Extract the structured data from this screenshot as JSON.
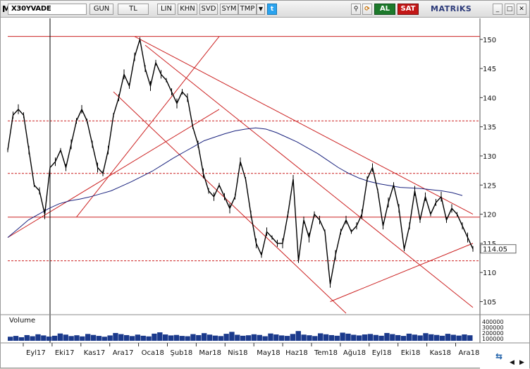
{
  "toolbar": {
    "symbol": "X30YVADE",
    "period": "GUN",
    "currency": "TL",
    "buttons": [
      "LIN",
      "KHN",
      "SVD",
      "SYM",
      "TMP"
    ],
    "buy": "AL",
    "sell": "SAT",
    "brand": "MATRiKS"
  },
  "chart_data": {
    "type": "line",
    "price_ticks": [
      150,
      145,
      140,
      135,
      130,
      125,
      120,
      115,
      110,
      105
    ],
    "last_price": "114.05",
    "x_labels": [
      "Eyl17",
      "Eki17",
      "Kas17",
      "Ara17",
      "Oca18",
      "Şub18",
      "Mar18",
      "Nis18",
      "May18",
      "Haz18",
      "Tem18",
      "Ağu18",
      "Eyl18",
      "Eki18",
      "Kas18",
      "Ara18"
    ],
    "volume_title": "Volume",
    "volume_ticks": [
      "400000",
      "300000",
      "200000",
      "100000"
    ],
    "series": [
      {
        "values": [
          131,
          137,
          138,
          137,
          131,
          125,
          124,
          120,
          128,
          129,
          131,
          128,
          132,
          136,
          138,
          136,
          132,
          128,
          127,
          131,
          137,
          140,
          144,
          142,
          147,
          150,
          145,
          142,
          146,
          144,
          143,
          141,
          139,
          141,
          140,
          135,
          132,
          127,
          124,
          123,
          125,
          123,
          121,
          123,
          129,
          126,
          120,
          115,
          113,
          117,
          116,
          115,
          115,
          120,
          126,
          112,
          119,
          116,
          120,
          119,
          117,
          108,
          113,
          117,
          119,
          117,
          118,
          120,
          126,
          128,
          124,
          118,
          122,
          125,
          121,
          114,
          118,
          124,
          119,
          123,
          120,
          122,
          123,
          119,
          121,
          120,
          118,
          116,
          114.05
        ]
      },
      {
        "values": [
          116,
          117.5,
          119,
          120,
          121,
          121.8,
          122.3,
          122.6,
          123,
          123.5,
          124,
          124.8,
          125.6,
          126.5,
          127.4,
          128.5,
          129.6,
          130.6,
          131.6,
          132.6,
          133.2,
          133.8,
          134.3,
          134.6,
          134.8,
          134.6,
          134,
          133.2,
          132.4,
          131.4,
          130.4,
          129.2,
          128,
          127,
          126.2,
          125.6,
          125.2,
          124.9,
          124.6,
          124.5,
          124.4,
          124.2,
          124,
          123.7,
          123.2
        ]
      }
    ],
    "ylim": [
      103,
      153
    ],
    "volumes": [
      0.25,
      0.3,
      0.22,
      0.35,
      0.28,
      0.4,
      0.33,
      0.26,
      0.31,
      0.45,
      0.38,
      0.29,
      0.34,
      0.27,
      0.42,
      0.36,
      0.3,
      0.25,
      0.33,
      0.48,
      0.41,
      0.35,
      0.29,
      0.38,
      0.31,
      0.27,
      0.44,
      0.52,
      0.39,
      0.33,
      0.36,
      0.3,
      0.28,
      0.41,
      0.35,
      0.47,
      0.38,
      0.32,
      0.29,
      0.43,
      0.55,
      0.37,
      0.31,
      0.34,
      0.4,
      0.36,
      0.28,
      0.45,
      0.39,
      0.33,
      0.3,
      0.42,
      0.6,
      0.38,
      0.34,
      0.29,
      0.46,
      0.4,
      0.35,
      0.31,
      0.5,
      0.44,
      0.37,
      0.33,
      0.39,
      0.42,
      0.36,
      0.31,
      0.48,
      0.41,
      0.35,
      0.3,
      0.44,
      0.38,
      0.33,
      0.47,
      0.4,
      0.36,
      0.31,
      0.43,
      0.37,
      0.32,
      0.39,
      0.34
    ]
  },
  "colors": {
    "price": "#000000",
    "ma": "#1a237e",
    "lines": "#cc2222",
    "volume": "#1b3a8c"
  }
}
